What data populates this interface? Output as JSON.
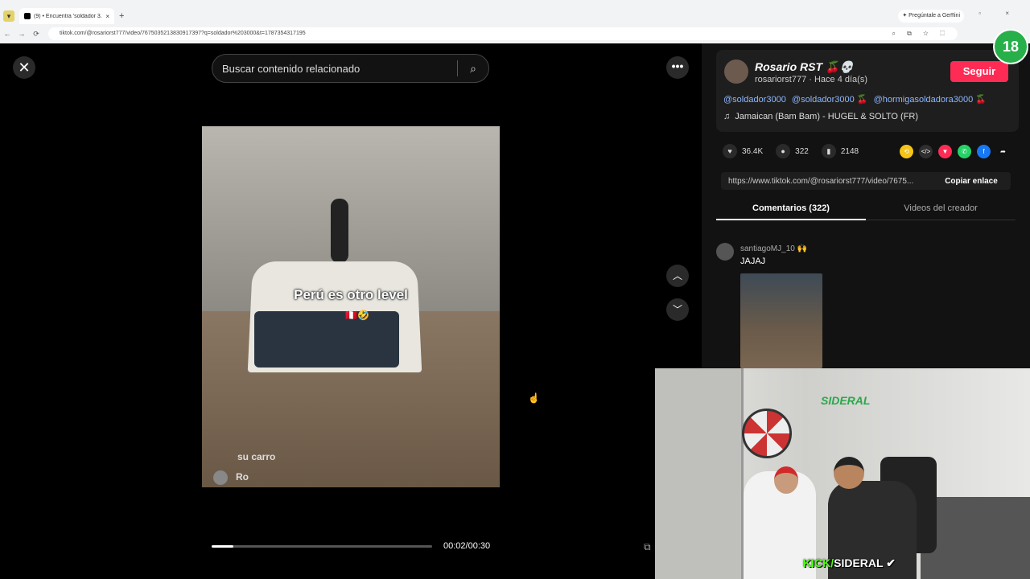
{
  "browser": {
    "tab_title": "(9) • Encuentra 'soldador 3...",
    "tab_close": "×",
    "new_tab": "+",
    "gemini_label": "✦ Pregúntale a Gemini",
    "window_controls": "–  ▫  ×",
    "url": "tiktok.com/@rosariorst777/video/7675035213830917397?q=soldador%203000&t=1787354317195",
    "back": "←",
    "forward": "→",
    "reload": "⟳",
    "omni_icons": "⌕ ⧉ ☆ ⬚",
    "extension_badge": "18"
  },
  "player": {
    "close_icon": "✕",
    "search_placeholder": "Buscar contenido relacionado",
    "search_icon": "⌕",
    "more_icon": "•••",
    "overlay_text": "Perú es otro level",
    "overlay_emoji": "🇵🇪🤣",
    "caption_partial": "su carro",
    "caption_user": "Ro",
    "timecode": "00:02/00:30",
    "progress": 0.1,
    "nav_up": "︿",
    "nav_down": "﹀",
    "cursor": "☝",
    "float_icon": "⧉"
  },
  "panel": {
    "display_name": "Rosario RST 🍒💀",
    "handle_line": "rosariorst777 · Hace 4 día(s)",
    "follow_label": "Seguir",
    "mentions": [
      "@soldador3000",
      "@soldador3000 🍒",
      "@hormigasoldadora3000 🍒"
    ],
    "music_icon": "♫",
    "music": "Jamaican (Bam Bam) - HUGEL & SOLTO (FR)",
    "likes": "36.4K",
    "comments_count": "322",
    "saves": "2148",
    "like_icon": "♥",
    "comment_icon": "●",
    "save_icon": "▮",
    "share_icons": [
      {
        "name": "repost-icon",
        "glyph": "⟲",
        "color": "#f5c518"
      },
      {
        "name": "embed-icon",
        "glyph": "</>",
        "color": "#2f2f2f"
      },
      {
        "name": "send-icon",
        "glyph": "▼",
        "color": "#fe2c55"
      },
      {
        "name": "whatsapp-icon",
        "glyph": "✆",
        "color": "#25d366"
      },
      {
        "name": "facebook-icon",
        "glyph": "f",
        "color": "#1877f2"
      },
      {
        "name": "share-arrow-icon",
        "glyph": "➦",
        "color": "#121212"
      }
    ],
    "share_url": "https://www.tiktok.com/@rosariorst777/video/7675...",
    "copy_label": "Copiar enlace",
    "tab_comments": "Comentarios (322)",
    "tab_videos": "Videos del creador",
    "comment": {
      "user": "santiagoMJ_10 🙌",
      "text": "JAJAJ"
    }
  },
  "webcam": {
    "logo_text": "SIDERAL",
    "tag_kick": "KICK/",
    "tag_name": "SIDERAL ✔"
  }
}
